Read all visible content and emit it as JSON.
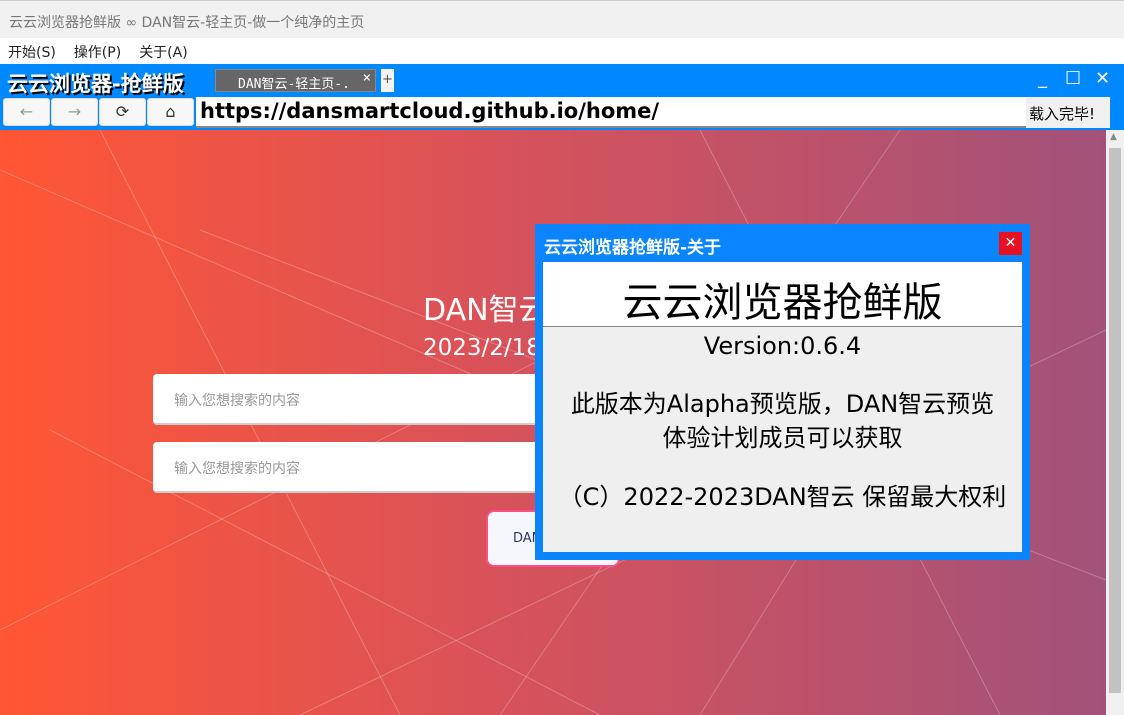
{
  "window": {
    "title": "云云浏览器抢鲜版 ∞ DAN智云-轻主页-做一个纯净的主页"
  },
  "menu": [
    "开始(S)",
    "操作(P)",
    "关于(A)"
  ],
  "browser": {
    "brand": "云云浏览器-抢鲜版",
    "tab_label": "DAN智云-轻主页-.",
    "tab_close": "×",
    "new_tab": "+",
    "minimize": "_",
    "maximize": "☐",
    "close": "✕",
    "back": "←",
    "forward": "→",
    "reload": "⟳",
    "home": "⌂",
    "url": "https://dansmartcloud.github.io/home/",
    "status": "载入完毕!"
  },
  "page": {
    "heading": "DAN智云",
    "date": "2023/2/18",
    "search1_placeholder": "输入您想搜索的内容",
    "search2_placeholder": "输入您想搜索的内容",
    "button_label": "DAN"
  },
  "dialog": {
    "title": "云云浏览器抢鲜版-关于",
    "close": "✕",
    "app_name": "云云浏览器抢鲜版",
    "version": "Version:0.6.4",
    "notice_line1": "此版本为Alapha预览版，DAN智云预览",
    "notice_line2": "体验计划成员可以获取",
    "copyright": "（C）2022-2023DAN智云 保留最大权利"
  }
}
